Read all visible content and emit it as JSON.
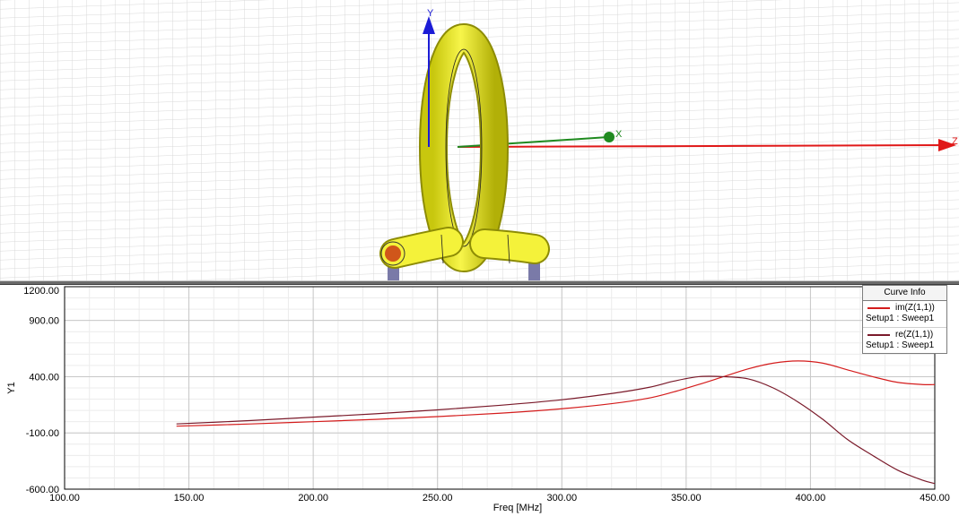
{
  "viewport": {
    "axis_labels": {
      "y": "Y",
      "x": "X",
      "z": "Z"
    },
    "colors": {
      "coil": "#f0ef2a",
      "grid": "#d8d8d8",
      "x_axis": "#1f8a1f",
      "y_axis": "#1c1cd6",
      "z_axis": "#e01818",
      "port": "#d0561a",
      "post": "#7a7aa8"
    }
  },
  "legend": {
    "title": "Curve Info",
    "entries": [
      {
        "name": "im(Z(1,1))",
        "setup": "Setup1 : Sweep1",
        "color": "#d41c1c"
      },
      {
        "name": "re(Z(1,1))",
        "setup": "Setup1 : Sweep1",
        "color": "#7a1a2a"
      }
    ]
  },
  "chart_data": {
    "type": "line",
    "xlabel": "Freq [MHz]",
    "ylabel": "Y1",
    "xlim": [
      100,
      450
    ],
    "ylim": [
      -600,
      1200
    ],
    "x_ticks": [
      "100.00",
      "150.00",
      "200.00",
      "250.00",
      "300.00",
      "350.00",
      "400.00",
      "450.00"
    ],
    "y_ticks": [
      "1200.00",
      "900.00",
      "400.00",
      "-100.00",
      "-600.00"
    ],
    "y_tick_values": [
      1200,
      900,
      400,
      -100,
      -600
    ],
    "grid": true,
    "legend_position": "top-right",
    "series": [
      {
        "name": "im(Z(1,1))",
        "color": "#d41c1c",
        "x": [
          145,
          175,
          200,
          225,
          250,
          275,
          300,
          320,
          335,
          345,
          355,
          365,
          375,
          385,
          395,
          405,
          415,
          425,
          435,
          445,
          450
        ],
        "y": [
          -40,
          -20,
          0,
          20,
          45,
          75,
          115,
          160,
          210,
          265,
          330,
          400,
          470,
          520,
          540,
          520,
          460,
          400,
          350,
          330,
          330
        ]
      },
      {
        "name": "re(Z(1,1))",
        "color": "#7a1a2a",
        "x": [
          145,
          175,
          200,
          225,
          250,
          275,
          300,
          320,
          335,
          345,
          355,
          365,
          375,
          385,
          395,
          405,
          415,
          425,
          435,
          445,
          450
        ],
        "y": [
          -20,
          10,
          40,
          70,
          105,
          145,
          195,
          250,
          305,
          360,
          400,
          400,
          380,
          300,
          175,
          20,
          -160,
          -300,
          -430,
          -520,
          -550
        ]
      }
    ]
  }
}
